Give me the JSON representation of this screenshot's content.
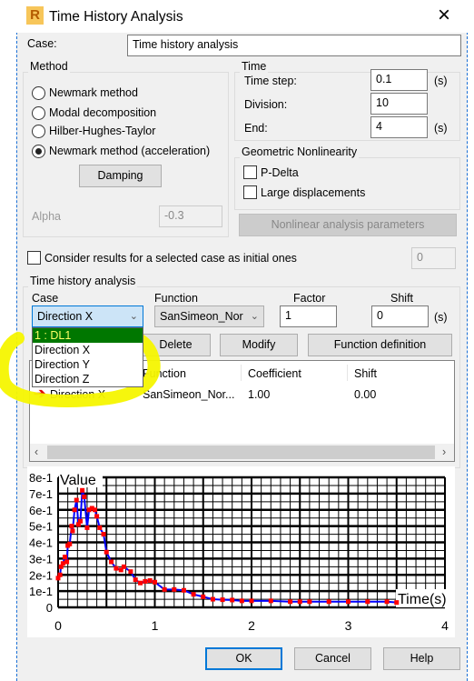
{
  "window": {
    "title": "Time History Analysis",
    "icon": "robot-app-icon",
    "close": "×"
  },
  "case": {
    "label": "Case:",
    "value": "Time history analysis"
  },
  "method": {
    "label": "Method",
    "options": [
      "Newmark method",
      "Modal decomposition",
      "Hilber-Hughes-Taylor",
      "Newmark method (acceleration)"
    ],
    "selected": 3,
    "damping": "Damping",
    "alpha_label": "Alpha",
    "alpha_value": "-0.3"
  },
  "time": {
    "label": "Time",
    "step_label": "Time step:",
    "step": "0.1",
    "division_label": "Division:",
    "division": "10",
    "end_label": "End:",
    "end": "4",
    "unit": "(s)"
  },
  "geom": {
    "label": "Geometric Nonlinearity",
    "pdelta": "P-Delta",
    "large": "Large displacements",
    "nonlinear_btn": "Nonlinear analysis parameters"
  },
  "consider": {
    "label": "Consider results for a selected case as initial ones",
    "value": "0"
  },
  "tha": {
    "label": "Time history analysis",
    "case_label": "Case",
    "case_value": "Direction X",
    "function_label": "Function",
    "function_value": "SanSimeon_Nor",
    "factor_label": "Factor",
    "factor": "1",
    "shift_label": "Shift",
    "shift": "0",
    "unit": "(s)",
    "dropdown": [
      "1 : DL1",
      "Direction X",
      "Direction Y",
      "Direction Z"
    ],
    "buttons": {
      "delete": "Delete",
      "modify": "Modify",
      "function_definition": "Function definition"
    },
    "columns": [
      "Function",
      "Coefficient",
      "Shift"
    ],
    "rows": [
      {
        "case": "Direction X",
        "function": "SanSimeon_Nor...",
        "coefficient": "1.00",
        "shift": "0.00"
      }
    ]
  },
  "colors": {
    "accent": "#0078d7",
    "dropdown_selected": "#007700",
    "dropdown_selected_text": "#ffff66",
    "highlight": "#f5f500",
    "line": "#0000ff",
    "marker": "#ff0000"
  },
  "chart_data": {
    "type": "line",
    "ylabel": "Value",
    "xlabel": "Time(s)",
    "xlim": [
      0,
      4
    ],
    "ylim": [
      0,
      0.8
    ],
    "grid": true,
    "xticks": [
      "0",
      "1",
      "2",
      "3",
      "4"
    ],
    "yticks": [
      "0",
      "1e-1",
      "2e-1",
      "3e-1",
      "4e-1",
      "5e-1",
      "6e-1",
      "7e-1",
      "8e-1"
    ],
    "x": [
      0,
      0.02,
      0.03,
      0.05,
      0.07,
      0.09,
      0.1,
      0.12,
      0.14,
      0.15,
      0.17,
      0.19,
      0.21,
      0.23,
      0.25,
      0.27,
      0.3,
      0.32,
      0.35,
      0.38,
      0.4,
      0.43,
      0.47,
      0.5,
      0.55,
      0.6,
      0.65,
      0.68,
      0.75,
      0.8,
      0.85,
      0.9,
      0.95,
      1.0,
      1.1,
      1.2,
      1.3,
      1.4,
      1.5,
      1.6,
      1.7,
      1.8,
      1.9,
      2.0,
      2.2,
      2.4,
      2.5,
      2.6,
      2.8,
      3.0,
      3.2,
      3.4,
      3.5
    ],
    "y": [
      0.18,
      0.2,
      0.25,
      0.27,
      0.31,
      0.28,
      0.38,
      0.39,
      0.5,
      0.47,
      0.6,
      0.66,
      0.51,
      0.53,
      0.72,
      0.68,
      0.49,
      0.6,
      0.61,
      0.6,
      0.56,
      0.49,
      0.45,
      0.34,
      0.28,
      0.24,
      0.23,
      0.25,
      0.22,
      0.17,
      0.15,
      0.16,
      0.165,
      0.155,
      0.11,
      0.11,
      0.105,
      0.08,
      0.065,
      0.05,
      0.047,
      0.045,
      0.04,
      0.04,
      0.04,
      0.035,
      0.035,
      0.035,
      0.035,
      0.035,
      0.035,
      0.035,
      0.03
    ]
  },
  "footer": {
    "ok": "OK",
    "cancel": "Cancel",
    "help": "Help"
  }
}
